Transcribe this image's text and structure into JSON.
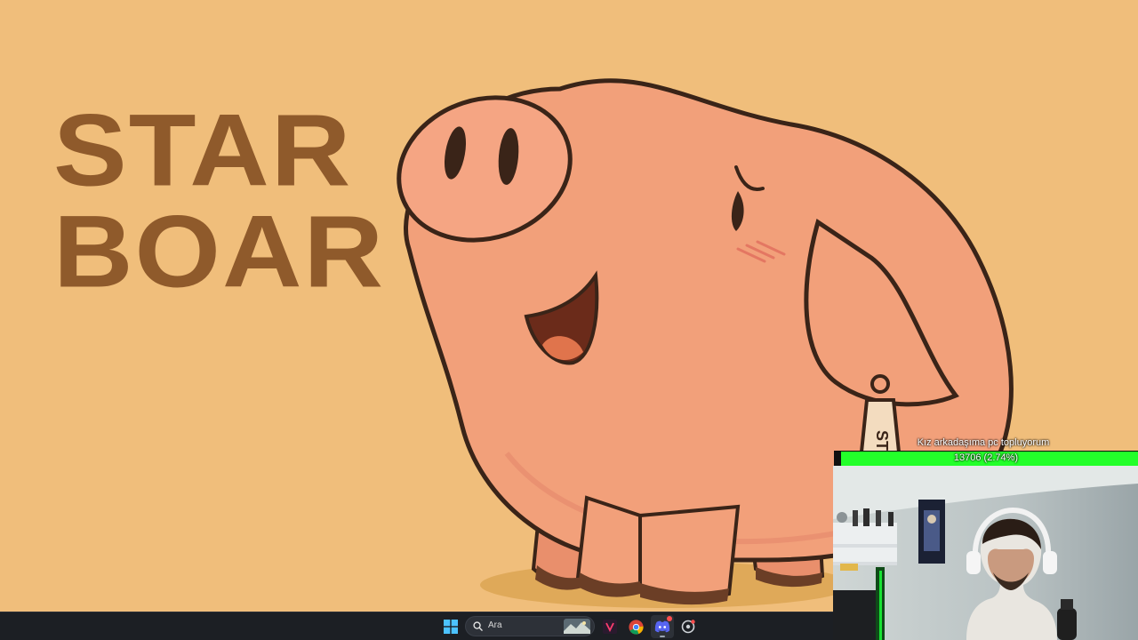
{
  "desktop": {
    "wallpaper_title_line1": "STAR",
    "wallpaper_title_line2": "BOAR",
    "pig_tag_text": "ST",
    "colors": {
      "background": "#f0be7b",
      "title": "#8f5a2b",
      "pig_body": "#f2a07a",
      "outline": "#3a2418"
    }
  },
  "stream_overlay": {
    "goal_label": "Kız arkadaşıma pc topluyorum",
    "goal_value": "13706 (2.74%)",
    "goal_progress_percent": 2.74,
    "goal_bar_color": "#23ff2a"
  },
  "taskbar": {
    "start_icon": "windows-icon",
    "search_placeholder": "Ara",
    "search_icon": "search-icon",
    "pinned_apps": [
      {
        "name": "widget-landscape-icon"
      },
      {
        "name": "app-v-icon"
      },
      {
        "name": "chrome-icon"
      },
      {
        "name": "discord-icon"
      },
      {
        "name": "settings-app-icon"
      }
    ]
  }
}
